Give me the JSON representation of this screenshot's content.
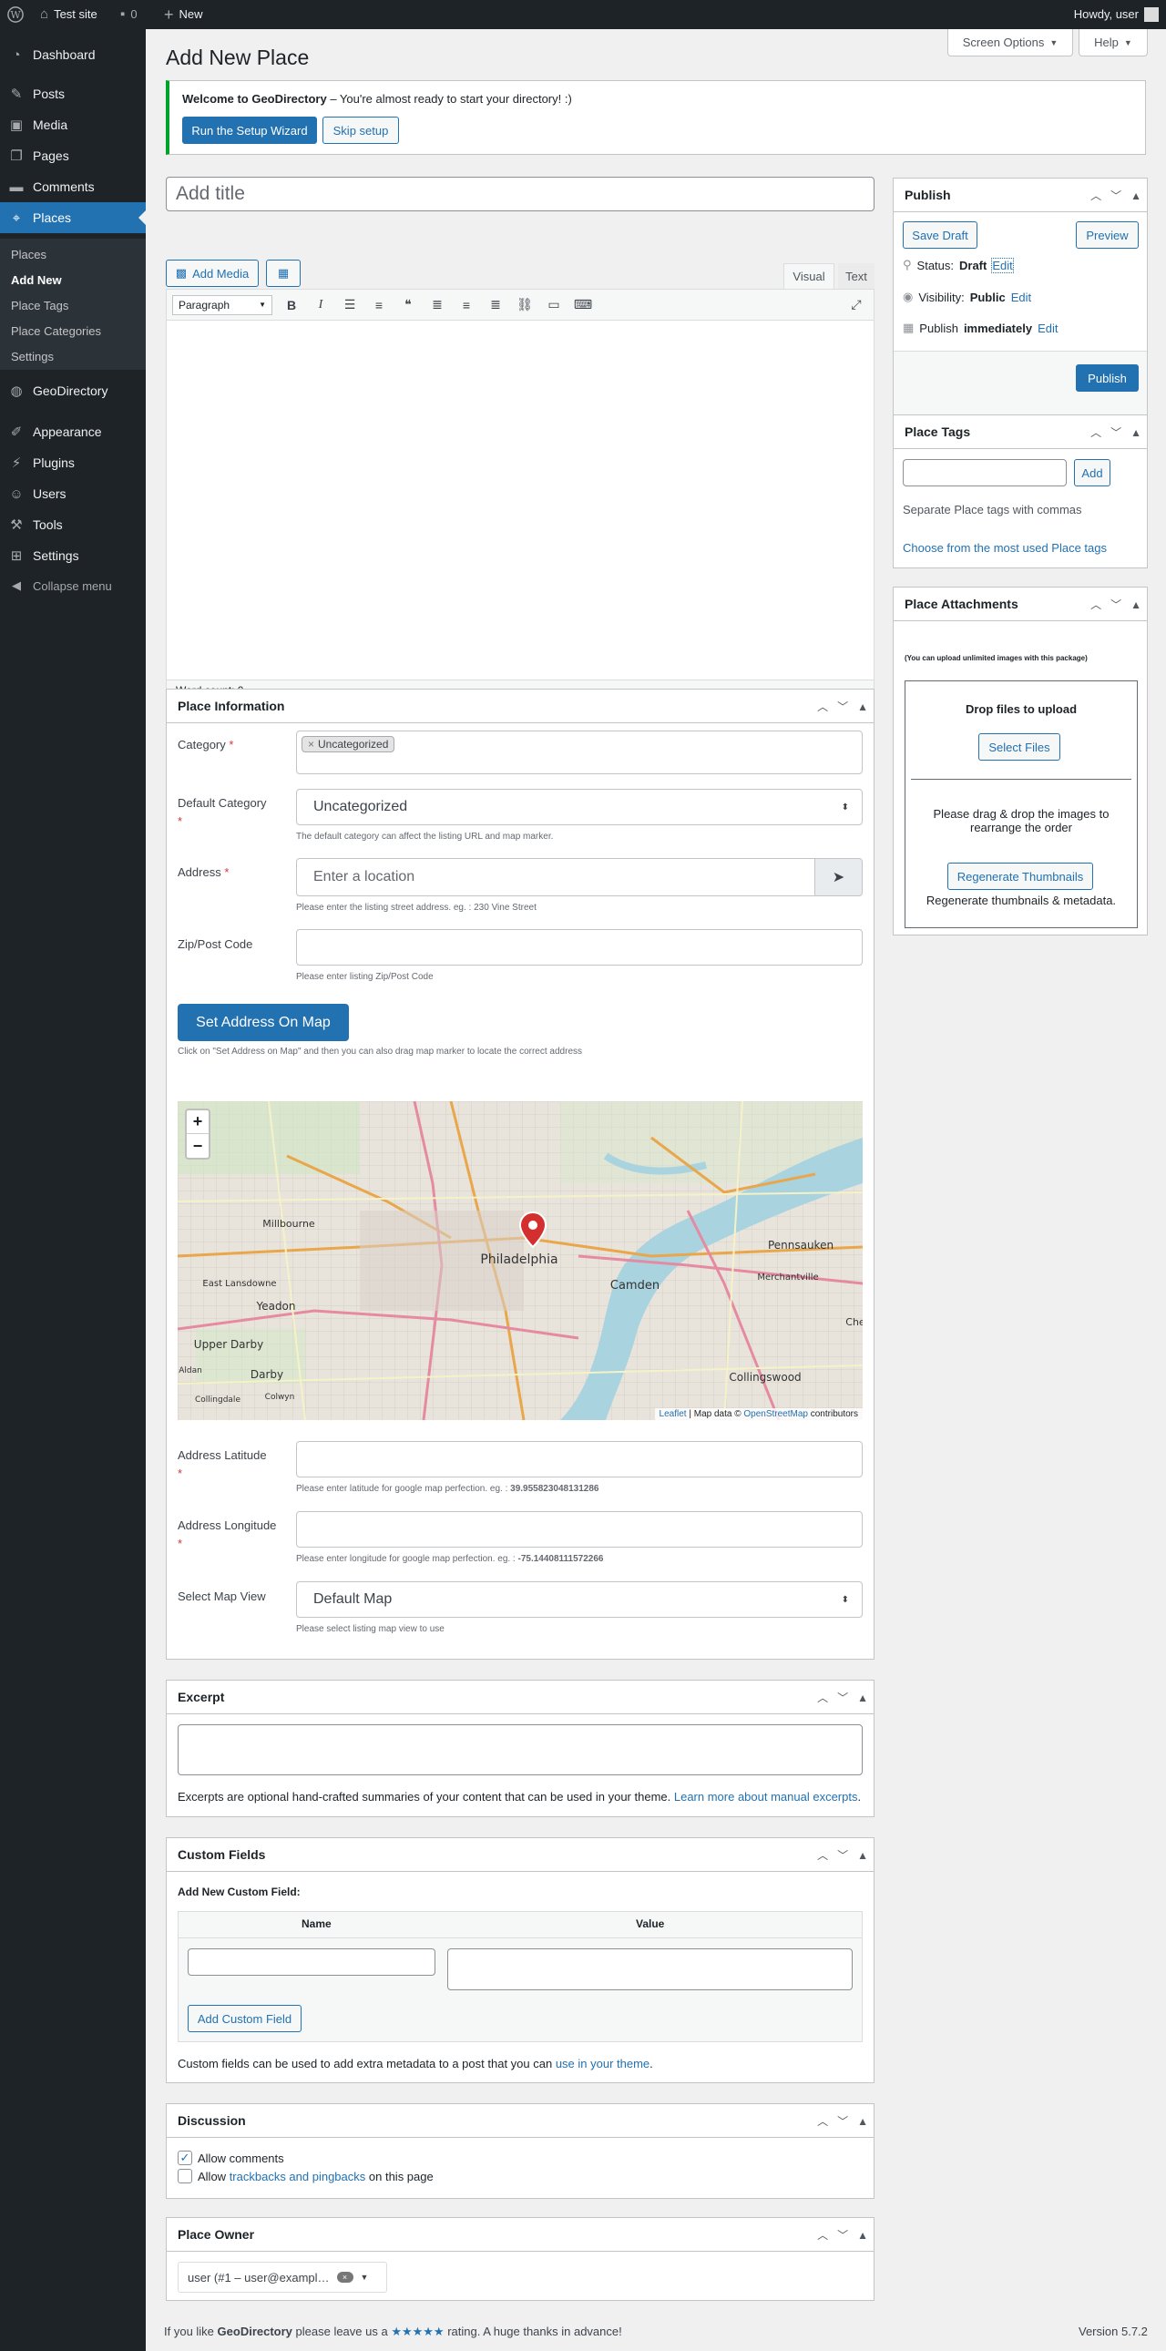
{
  "adminbar": {
    "site": "Test site",
    "comments_count": "0",
    "new": "New",
    "howdy": "Howdy, user"
  },
  "menu": {
    "dashboard": "Dashboard",
    "posts": "Posts",
    "media": "Media",
    "pages": "Pages",
    "comments": "Comments",
    "places": "Places",
    "sub": [
      "Places",
      "Add New",
      "Place Tags",
      "Place Categories",
      "Settings"
    ],
    "geodirectory": "GeoDirectory",
    "appearance": "Appearance",
    "plugins": "Plugins",
    "users": "Users",
    "tools": "Tools",
    "settings": "Settings",
    "collapse": "Collapse menu"
  },
  "page": {
    "title": "Add New Place",
    "screen_options": "Screen Options",
    "help": "Help"
  },
  "notice": {
    "bold": "Welcome to GeoDirectory",
    "text": " – You're almost ready to start your directory! :)",
    "wizard": "Run the Setup Wizard",
    "skip": "Skip setup"
  },
  "editor": {
    "title_placeholder": "Add title",
    "add_media": "Add Media",
    "tab_visual": "Visual",
    "tab_text": "Text",
    "format": "Paragraph",
    "word_count": "Word count: 0"
  },
  "place_info": {
    "title": "Place Information",
    "category_label": "Category",
    "category_tag": "Uncategorized",
    "default_category_label": "Default Category",
    "default_category_value": "Uncategorized",
    "default_category_help": "The default category can affect the listing URL and map marker.",
    "address_label": "Address",
    "address_placeholder": "Enter a location",
    "address_help": "Please enter the listing street address. eg. : 230 Vine Street",
    "zip_label": "Zip/Post Code",
    "zip_help": "Please enter listing Zip/Post Code",
    "set_address_btn": "Set Address On Map",
    "set_address_help": "Click on \"Set Address on Map\" and then you can also drag map marker to locate the correct address",
    "lat_label": "Address Latitude",
    "lat_help": "Please enter latitude for google map perfection. eg. : ",
    "lat_example": "39.955823048131286",
    "lng_label": "Address Longitude",
    "lng_help": "Please enter longitude for google map perfection. eg. : ",
    "lng_example": "-75.14408111572266",
    "mapview_label": "Select Map View",
    "mapview_value": "Default Map",
    "mapview_help": "Please select listing map view to use"
  },
  "map": {
    "zoom_in": "+",
    "zoom_out": "−",
    "labels": [
      "Millbourne",
      "Philadelphia",
      "Pennsauken",
      "Merchantville",
      "East Lansdowne",
      "Yeadon",
      "Camden",
      "Upper Darby",
      "Darby",
      "Collingswood",
      "Aldan",
      "Collingdale",
      "Colwyn",
      "Che"
    ],
    "attr_leaflet": "Leaflet",
    "attr_mid": " | Map data © ",
    "attr_osm": "OpenStreetMap",
    "attr_end": " contributors"
  },
  "excerpt": {
    "title": "Excerpt",
    "help": "Excerpts are optional hand-crafted summaries of your content that can be used in your theme. ",
    "link": "Learn more about manual excerpts",
    "end": "."
  },
  "custom_fields": {
    "title": "Custom Fields",
    "add_new": "Add New Custom Field:",
    "col_name": "Name",
    "col_value": "Value",
    "button": "Add Custom Field",
    "help": "Custom fields can be used to add extra metadata to a post that you can ",
    "link": "use in your theme",
    "end": "."
  },
  "discussion": {
    "title": "Discussion",
    "allow_comments": "Allow comments",
    "allow_prefix": "Allow ",
    "trackbacks_link": "trackbacks and pingbacks",
    "allow_suffix": " on this page"
  },
  "owner": {
    "title": "Place Owner",
    "value": "user (#1 – user@exampl…"
  },
  "publish": {
    "title": "Publish",
    "save_draft": "Save Draft",
    "preview": "Preview",
    "status_label": "Status: ",
    "status_value": "Draft",
    "visibility_label": "Visibility: ",
    "visibility_value": "Public",
    "publish_label": "Publish ",
    "publish_value": "immediately",
    "edit": "Edit",
    "button": "Publish"
  },
  "tags": {
    "title": "Place Tags",
    "add": "Add",
    "help": "Separate Place tags with commas",
    "link": "Choose from the most used Place tags"
  },
  "attachments": {
    "title": "Place Attachments",
    "note": "(You can upload unlimited images with this package)",
    "drop": "Drop files to upload",
    "select": "Select Files",
    "reorder": "Please drag & drop the images to rearrange the order",
    "regen": "Regenerate Thumbnails",
    "regen_help": "Regenerate thumbnails & metadata."
  },
  "footer": {
    "pre": "If you like ",
    "brand": "GeoDirectory",
    "mid": " please leave us a ",
    "stars": "★★★★★",
    "post": " rating. A huge thanks in advance!",
    "version": "Version 5.7.2"
  }
}
